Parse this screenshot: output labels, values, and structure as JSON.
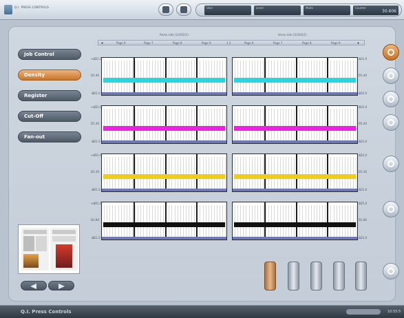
{
  "app": {
    "logo_text": "Q.I. PRESS CONTROLS",
    "footer_title": "Q.I. Press Controls",
    "footer_status": "",
    "clock": "10:55:5"
  },
  "status_fields": [
    {
      "label": "User",
      "value": ""
    },
    {
      "label": "Level",
      "value": ""
    },
    {
      "label": "Mode",
      "value": ""
    },
    {
      "label": "Counter",
      "value": "30.606"
    }
  ],
  "nav": [
    {
      "label": "Job Control",
      "active": false
    },
    {
      "label": "Density",
      "active": true
    },
    {
      "label": "Register",
      "active": false
    },
    {
      "label": "Cut-Off",
      "active": false
    },
    {
      "label": "Fan-out",
      "active": false
    }
  ],
  "header": {
    "left_title": "Recto side (2/3/02/1)",
    "right_title": "Verso side (2/3/02/1)",
    "center_mark": "1 2",
    "pages_left": [
      "Page 6",
      "Page 7",
      "Page 8",
      "Page 9"
    ],
    "pages_right": [
      "Page 6",
      "Page 7",
      "Page 8",
      "Page 9"
    ]
  },
  "density_rows": [
    {
      "color": "#27d6df",
      "left_top": "+ΔD1.0",
      "left_mid": "D1.40",
      "left_bot": "-ΔD1.0",
      "right_top": "ΔD1.0",
      "right_mid": "D1.40",
      "right_bot": "ΔD1.0"
    },
    {
      "color": "#ee21e3",
      "left_top": "+ΔD1.0",
      "left_mid": "D1.40",
      "left_bot": "-ΔD1.0",
      "right_top": "ΔD1.0",
      "right_mid": "D1.40",
      "right_bot": "ΔD1.0"
    },
    {
      "color": "#f2cc1c",
      "left_top": "+ΔD1.0",
      "left_mid": "D1.30",
      "left_bot": "-ΔD1.0",
      "right_top": "ΔD1.0",
      "right_mid": "D1.30",
      "right_bot": "ΔD1.0"
    },
    {
      "color": "#111111",
      "left_top": "+ΔD1.0",
      "left_mid": "D1.80",
      "left_bot": "-ΔD1.0",
      "right_top": "ΔD1.0",
      "right_mid": "D1.80",
      "right_bot": "ΔD1.0"
    }
  ],
  "right_tools": [
    "brush-icon",
    "paint-roller-icon",
    "wrench-icon",
    "ink-drop-icon",
    "save-icon",
    "grid-icon",
    "recycle-icon"
  ],
  "rollers": [
    {
      "name": "roller-1",
      "active": true
    },
    {
      "name": "roller-2",
      "active": false
    },
    {
      "name": "roller-3",
      "active": false
    },
    {
      "name": "roller-4",
      "active": false
    },
    {
      "name": "roller-5",
      "active": false
    }
  ]
}
